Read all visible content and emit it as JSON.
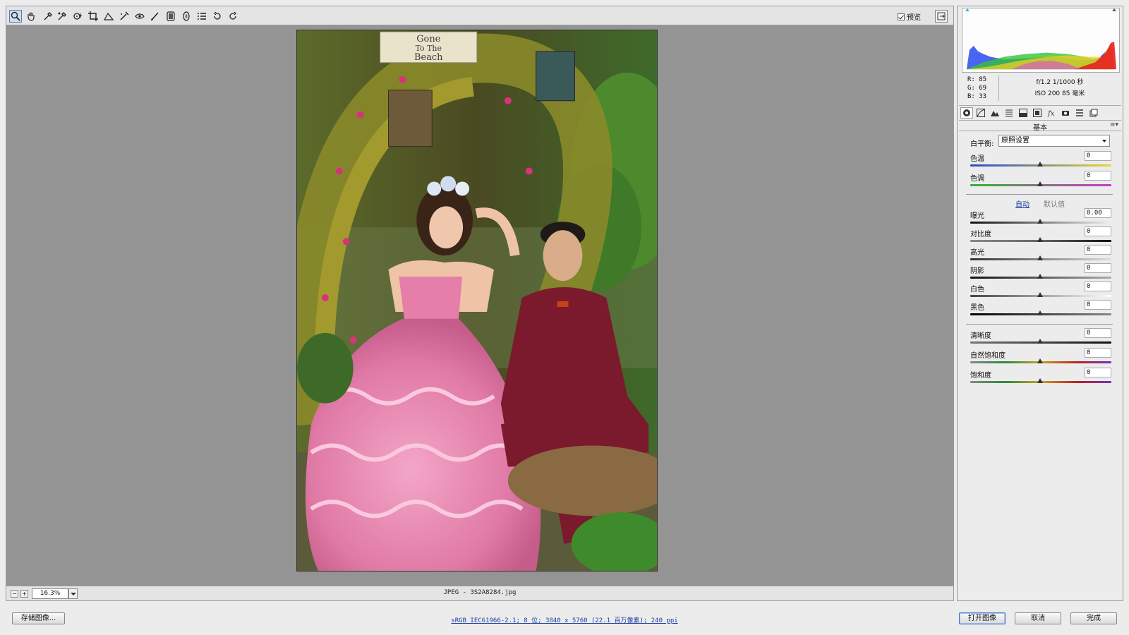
{
  "toolbar": {
    "tools": [
      "zoom-icon",
      "hand-icon",
      "white-balance-icon",
      "color-sampler-icon",
      "targeted-adjustment-icon",
      "crop-icon",
      "straighten-icon",
      "spot-removal-icon",
      "red-eye-icon",
      "adjustment-brush-icon",
      "graduated-filter-icon",
      "radial-filter-icon",
      "preferences-icon",
      "rotate-left-icon",
      "rotate-right-icon"
    ],
    "preview_label": "预览"
  },
  "statusbar": {
    "zoom": "16.3%",
    "file": "JPEG -  3S2A8284.jpg"
  },
  "photo": {
    "sign_lines": [
      "Gone",
      "To The",
      "Beach"
    ]
  },
  "info": {
    "r": "R:   85",
    "g": "G:   69",
    "b": "B:   33",
    "exif_line1": "f/1.2  1/1000 秒",
    "exif_line2": "ISO 200  85 毫米"
  },
  "panel": {
    "tabs": [
      "basic-icon",
      "tone-curve-icon",
      "detail-icon",
      "hsl-icon",
      "split-toning-icon",
      "lens-icon",
      "fx-icon",
      "camera-calibration-icon",
      "presets-icon",
      "snapshots-icon"
    ],
    "title": "基本",
    "wb_label": "白平衡:",
    "wb_value": "原照设置",
    "auto": "自动",
    "default": "默认值",
    "sliders": {
      "temp": {
        "label": "色温",
        "value": "0"
      },
      "tint": {
        "label": "色调",
        "value": "0"
      },
      "exposure": {
        "label": "曝光",
        "value": "0.00"
      },
      "contrast": {
        "label": "对比度",
        "value": "0"
      },
      "highlights": {
        "label": "高光",
        "value": "0"
      },
      "shadows": {
        "label": "阴影",
        "value": "0"
      },
      "whites": {
        "label": "白色",
        "value": "0"
      },
      "blacks": {
        "label": "黑色",
        "value": "0"
      },
      "clarity": {
        "label": "清晰度",
        "value": "0"
      },
      "vibrance": {
        "label": "自然饱和度",
        "value": "0"
      },
      "saturation": {
        "label": "饱和度",
        "value": "0"
      }
    }
  },
  "bottom": {
    "save": "存储图像...",
    "workflow": "sRGB IEC61966-2.1; 8 位; 3840 x 5760 (22.1 百万像素); 240 ppi",
    "open": "打开图像",
    "cancel": "取消",
    "done": "完成"
  },
  "colors": {
    "accent": "#1a3fa0",
    "canvas_bg": "#949494"
  }
}
